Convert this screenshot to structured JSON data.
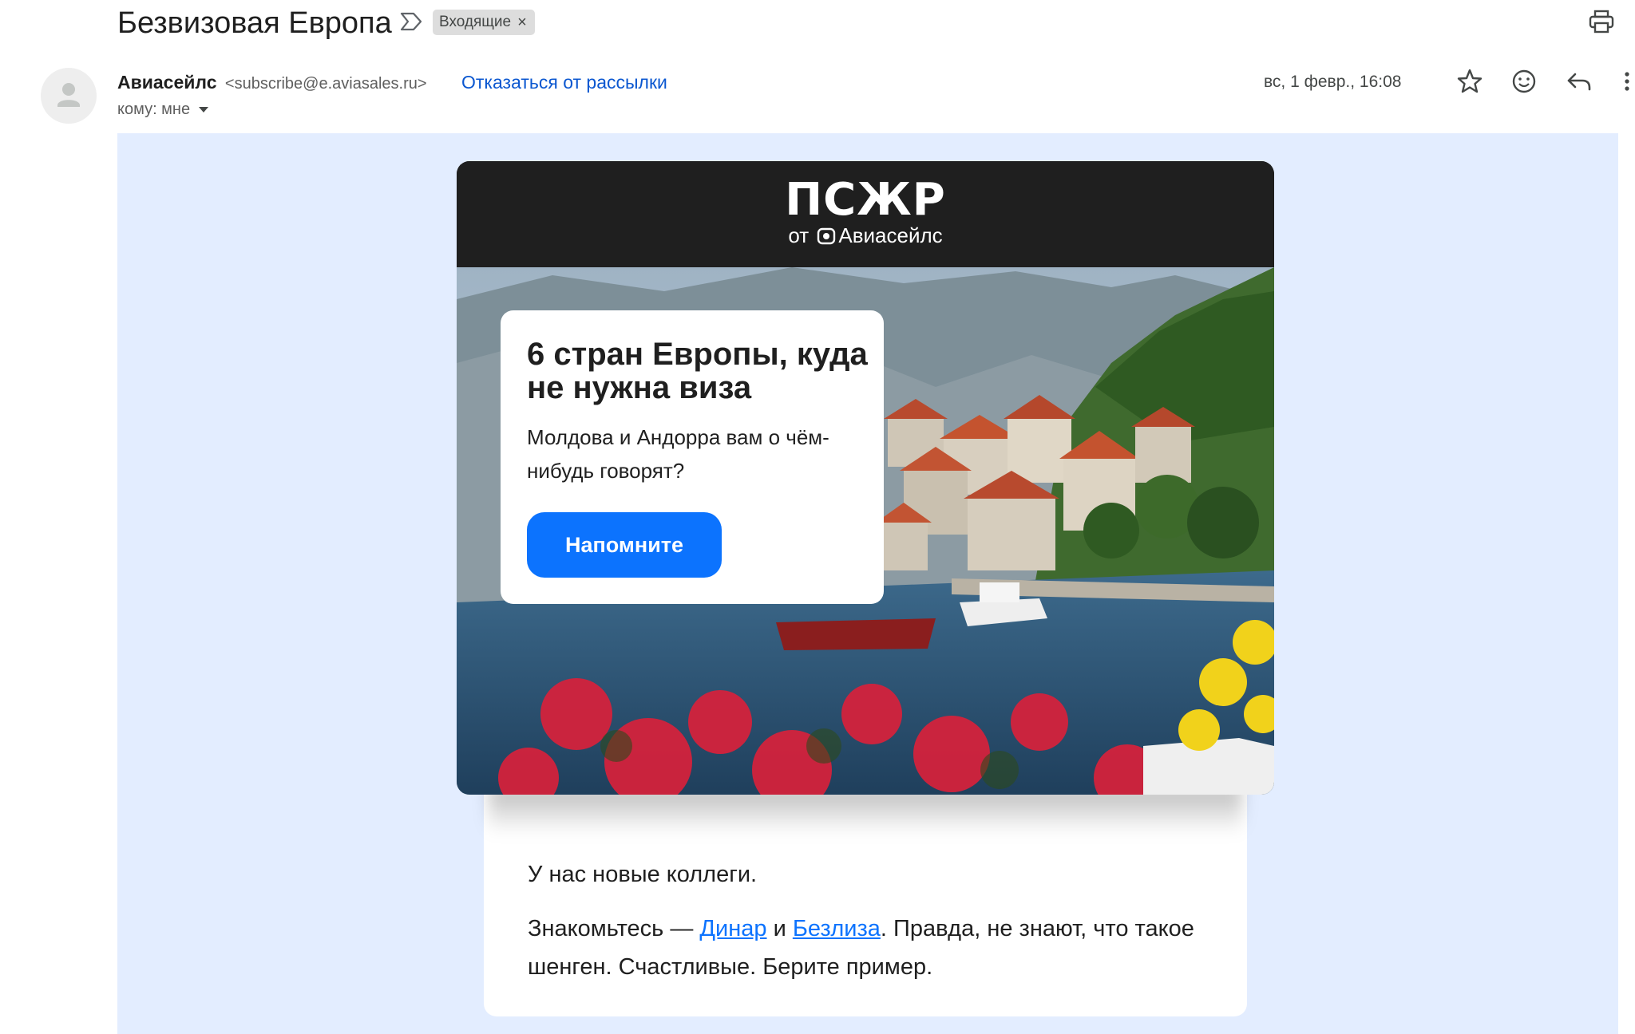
{
  "email": {
    "subject": "Безвизовая Европа",
    "label_chip": "Входящие",
    "label_remove": "×",
    "sender_name": "Авиасейлс",
    "sender_email": "<subscribe@e.aviasales.ru>",
    "unsubscribe": "Отказаться от рассылки",
    "recipient": "кому: мне",
    "date": "вс, 1 февр., 16:08"
  },
  "icons": {
    "important": "important-marker-icon",
    "print": "print-icon",
    "star": "star-icon",
    "emoji": "emoji-reaction-icon",
    "reply": "reply-icon",
    "more": "more-vert-icon",
    "avatar": "default-avatar-icon",
    "dropdown": "chevron-down-icon"
  },
  "newsletter": {
    "brand": "ПСЖР",
    "brand_by": "от",
    "brand_company": "Авиасейлс",
    "promo_title": "6 стран Европы, куда не нужна виза",
    "promo_text": "Молдова и Андорра вам о чём-нибудь говорят?",
    "promo_button": "Напомните",
    "para1": "У нас новые коллеги.",
    "para2_before": "Знакомьтесь — ",
    "link1": "Динар",
    "para2_mid": " и ",
    "link2": "Безлиза",
    "para2_after": ". Правда, не знают, что такое шенген. Счастливые. Берите пример."
  },
  "colors": {
    "body_background": "#e3edff",
    "header_dark": "#1f1f1f",
    "button_blue": "#0c73fe",
    "link_blue": "#0b57d0",
    "chip_gray": "#dddddd"
  }
}
